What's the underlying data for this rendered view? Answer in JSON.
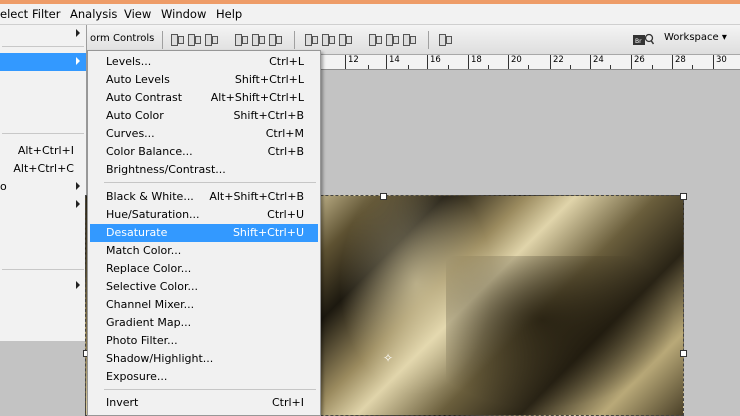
{
  "menubar": [
    "elect",
    "Filter",
    "Analysis",
    "View",
    "Window",
    "Help"
  ],
  "options_bar": {
    "transform_controls": "orm Controls",
    "workspace": "Workspace ▾"
  },
  "ruler_ticks": [
    "12",
    "14",
    "16",
    "18",
    "20",
    "22",
    "24",
    "26",
    "28",
    "30"
  ],
  "left_panel": {
    "shortcut_1": "Alt+Ctrl+I",
    "shortcut_2": "Alt+Ctrl+C",
    "partial_label": "o"
  },
  "submenu": {
    "items": [
      {
        "label": "Levels...",
        "shortcut": "Ctrl+L"
      },
      {
        "label": "Auto Levels",
        "shortcut": "Shift+Ctrl+L"
      },
      {
        "label": "Auto Contrast",
        "shortcut": "Alt+Shift+Ctrl+L"
      },
      {
        "label": "Auto Color",
        "shortcut": "Shift+Ctrl+B"
      },
      {
        "label": "Curves...",
        "shortcut": "Ctrl+M"
      },
      {
        "label": "Color Balance...",
        "shortcut": "Ctrl+B"
      },
      {
        "label": "Brightness/Contrast...",
        "shortcut": ""
      },
      {
        "label": "Black & White...",
        "shortcut": "Alt+Shift+Ctrl+B"
      },
      {
        "label": "Hue/Saturation...",
        "shortcut": "Ctrl+U"
      },
      {
        "label": "Desaturate",
        "shortcut": "Shift+Ctrl+U"
      },
      {
        "label": "Match Color...",
        "shortcut": ""
      },
      {
        "label": "Replace Color...",
        "shortcut": ""
      },
      {
        "label": "Selective Color...",
        "shortcut": ""
      },
      {
        "label": "Channel Mixer...",
        "shortcut": ""
      },
      {
        "label": "Gradient Map...",
        "shortcut": ""
      },
      {
        "label": "Photo Filter...",
        "shortcut": ""
      },
      {
        "label": "Shadow/Highlight...",
        "shortcut": ""
      },
      {
        "label": "Exposure...",
        "shortcut": ""
      },
      {
        "label": "Invert",
        "shortcut": "Ctrl+I"
      }
    ],
    "highlighted": "Desaturate"
  },
  "colors": {
    "highlight": "#3399ff",
    "menu_bg": "#f1f1f1",
    "canvas_bg": "#c3c3c3",
    "title_accent": "#ee9c68"
  }
}
